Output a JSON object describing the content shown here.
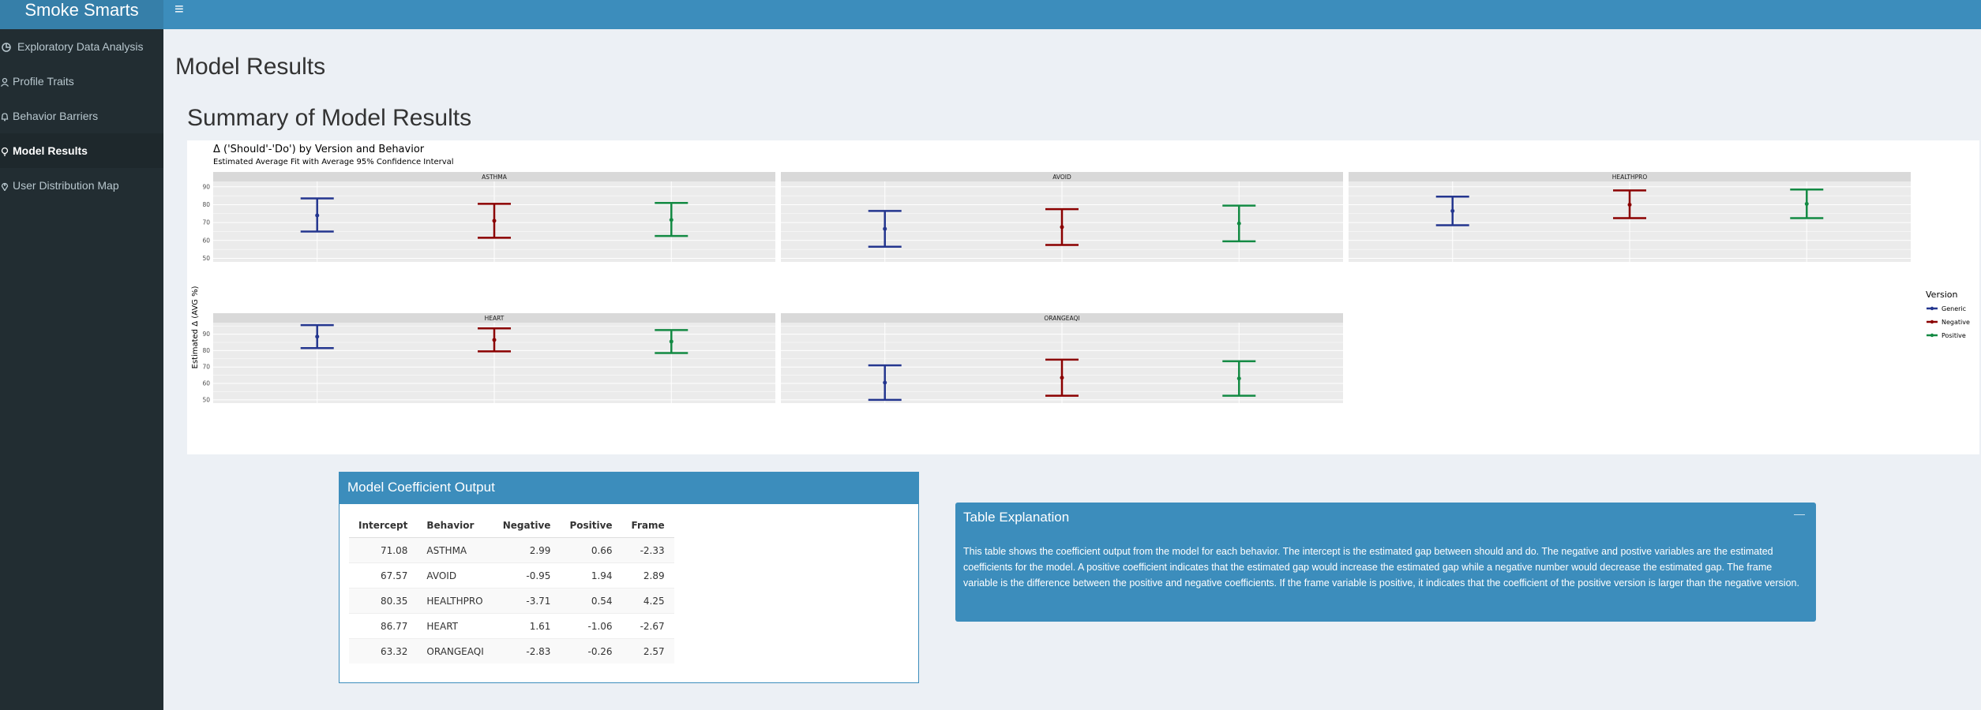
{
  "app": {
    "logo": "Smoke Smarts",
    "toggle_icon": "≡"
  },
  "sidebar": {
    "items": [
      {
        "label": "Exploratory Data Analysis",
        "icon": "chart-icon"
      },
      {
        "label": "Profile Traits",
        "icon": "user-icon"
      },
      {
        "label": "Behavior Barriers",
        "icon": "bell-icon"
      },
      {
        "label": "Model Results",
        "icon": "lightbulb-icon",
        "active": true
      },
      {
        "label": "User Distribution Map",
        "icon": "map-marker-icon"
      }
    ]
  },
  "main": {
    "page_title": "Model Results",
    "section_title": "Summary of Model Results"
  },
  "chart_data": {
    "type": "errorbar",
    "title": "Δ ('Should'-'Do') by Version and Behavior",
    "subtitle": "Estimated Average Fit with Average 95% Confidence Interval",
    "ylabel": "Estimated Δ (AVG %)",
    "yticks": [
      50,
      60,
      70,
      80,
      90
    ],
    "legend": {
      "title": "Version",
      "position": "right"
    },
    "series": [
      {
        "name": "Generic",
        "color": "#24368f"
      },
      {
        "name": "Negative",
        "color": "#8b0000"
      },
      {
        "name": "Positive",
        "color": "#138a43"
      }
    ],
    "panels": [
      {
        "name": "ASTHMA",
        "ylim": [
          48,
          93
        ],
        "points": [
          {
            "version": "Generic",
            "est": 74,
            "lo": 65,
            "hi": 83.5
          },
          {
            "version": "Negative",
            "est": 71,
            "lo": 61.5,
            "hi": 80.5
          },
          {
            "version": "Positive",
            "est": 71.5,
            "lo": 62.5,
            "hi": 81
          }
        ]
      },
      {
        "name": "AVOID",
        "ylim": [
          48,
          93
        ],
        "points": [
          {
            "version": "Generic",
            "est": 66.5,
            "lo": 56.5,
            "hi": 76.5
          },
          {
            "version": "Negative",
            "est": 67.5,
            "lo": 57.5,
            "hi": 77.5
          },
          {
            "version": "Positive",
            "est": 69.5,
            "lo": 59.5,
            "hi": 79.5
          }
        ]
      },
      {
        "name": "HEALTHPRO",
        "ylim": [
          48,
          93
        ],
        "points": [
          {
            "version": "Generic",
            "est": 76.5,
            "lo": 68.5,
            "hi": 84.5
          },
          {
            "version": "Negative",
            "est": 80,
            "lo": 72.5,
            "hi": 88
          }
        ]
      },
      {
        "name": "HEART",
        "ylim": [
          48,
          97
        ],
        "points": [
          {
            "version": "Generic",
            "est": 88.5,
            "lo": 81.5,
            "hi": 95.5
          },
          {
            "version": "Negative",
            "est": 86.5,
            "lo": 79.5,
            "hi": 93.5
          },
          {
            "version": "Positive",
            "est": 85.5,
            "lo": 78.5,
            "hi": 92.5
          }
        ]
      },
      {
        "name": "ORANGEAQI",
        "ylim": [
          48,
          97
        ],
        "points": [
          {
            "version": "Generic",
            "est": 60.5,
            "lo": 50,
            "hi": 71
          },
          {
            "version": "Negative",
            "est": 63.5,
            "lo": 52.5,
            "hi": 74.5
          },
          {
            "version": "Positive",
            "est": 63,
            "lo": 52.5,
            "hi": 73.5
          }
        ]
      }
    ],
    "extra_points": [
      {
        "panel": "HEALTHPRO",
        "version": "Positive",
        "est": 80.5,
        "lo": 72.5,
        "hi": 88.5
      }
    ]
  },
  "coef_box": {
    "title": "Model Coefficient Output",
    "columns": [
      "Intercept",
      "Behavior",
      "Negative",
      "Positive",
      "Frame"
    ],
    "rows": [
      [
        "71.08",
        "ASTHMA",
        "2.99",
        "0.66",
        "-2.33"
      ],
      [
        "67.57",
        "AVOID",
        "-0.95",
        "1.94",
        "2.89"
      ],
      [
        "80.35",
        "HEALTHPRO",
        "-3.71",
        "0.54",
        "4.25"
      ],
      [
        "86.77",
        "HEART",
        "1.61",
        "-1.06",
        "-2.67"
      ],
      [
        "63.32",
        "ORANGEAQI",
        "-2.83",
        "-0.26",
        "2.57"
      ]
    ]
  },
  "explanation": {
    "title": "Table Explanation",
    "minimize": "—",
    "text": "This table shows the coefficient output from the model for each behavior. The intercept is the estimated gap between should and do. The negative and postive variables are the estimated coefficients for the model. A positive coefficient indicates that the estimated gap would increase the estimated gap while a negative number would decrease the estimated gap. The frame variable is the difference between the positive and negative coefficients. If the frame variable is positive, it indicates that the coefficient of the positive version is larger than the negative version."
  }
}
